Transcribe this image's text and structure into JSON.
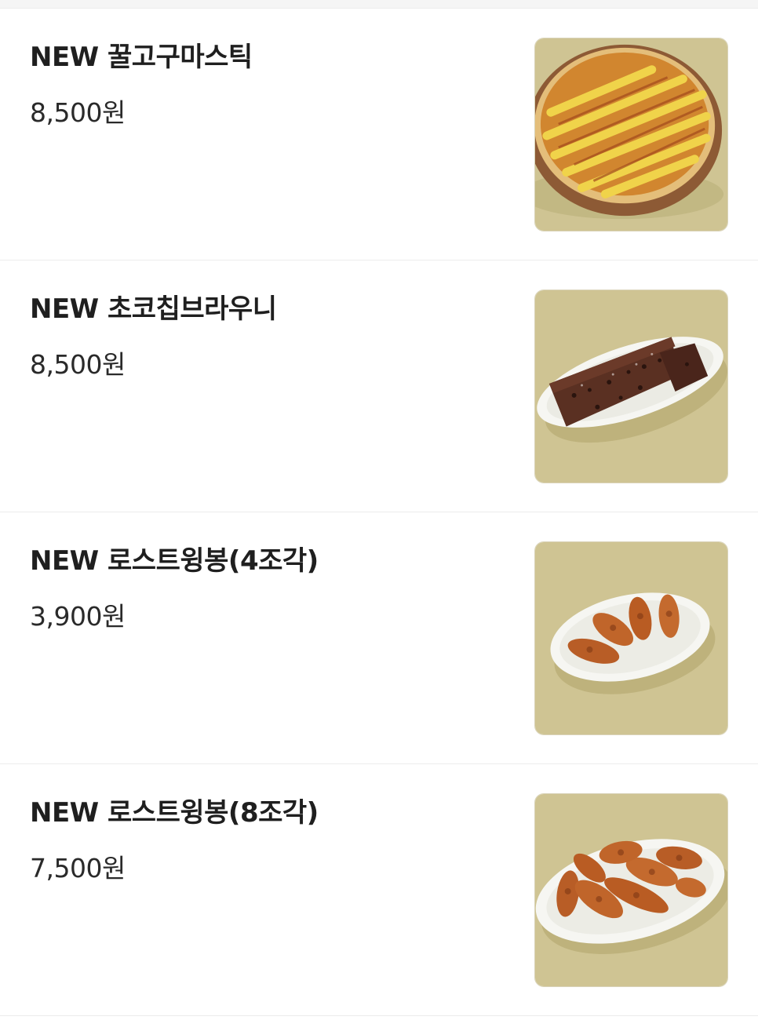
{
  "menu": {
    "items": [
      {
        "name": "NEW 꿀고구마스틱",
        "price": "8,500원",
        "image_icon": "sweet-potato-stick-pizza"
      },
      {
        "name": "NEW 초코칩브라우니",
        "price": "8,500원",
        "image_icon": "chocochip-brownie"
      },
      {
        "name": "NEW 로스트윙봉(4조각)",
        "price": "3,900원",
        "image_icon": "roast-wings-4"
      },
      {
        "name": "NEW 로스트윙봉(8조각)",
        "price": "7,500원",
        "image_icon": "roast-wings-8"
      }
    ]
  },
  "colors": {
    "thumb_bg": "#cfc493",
    "plate": "#f6f6f2",
    "wing": "#c0652a"
  }
}
